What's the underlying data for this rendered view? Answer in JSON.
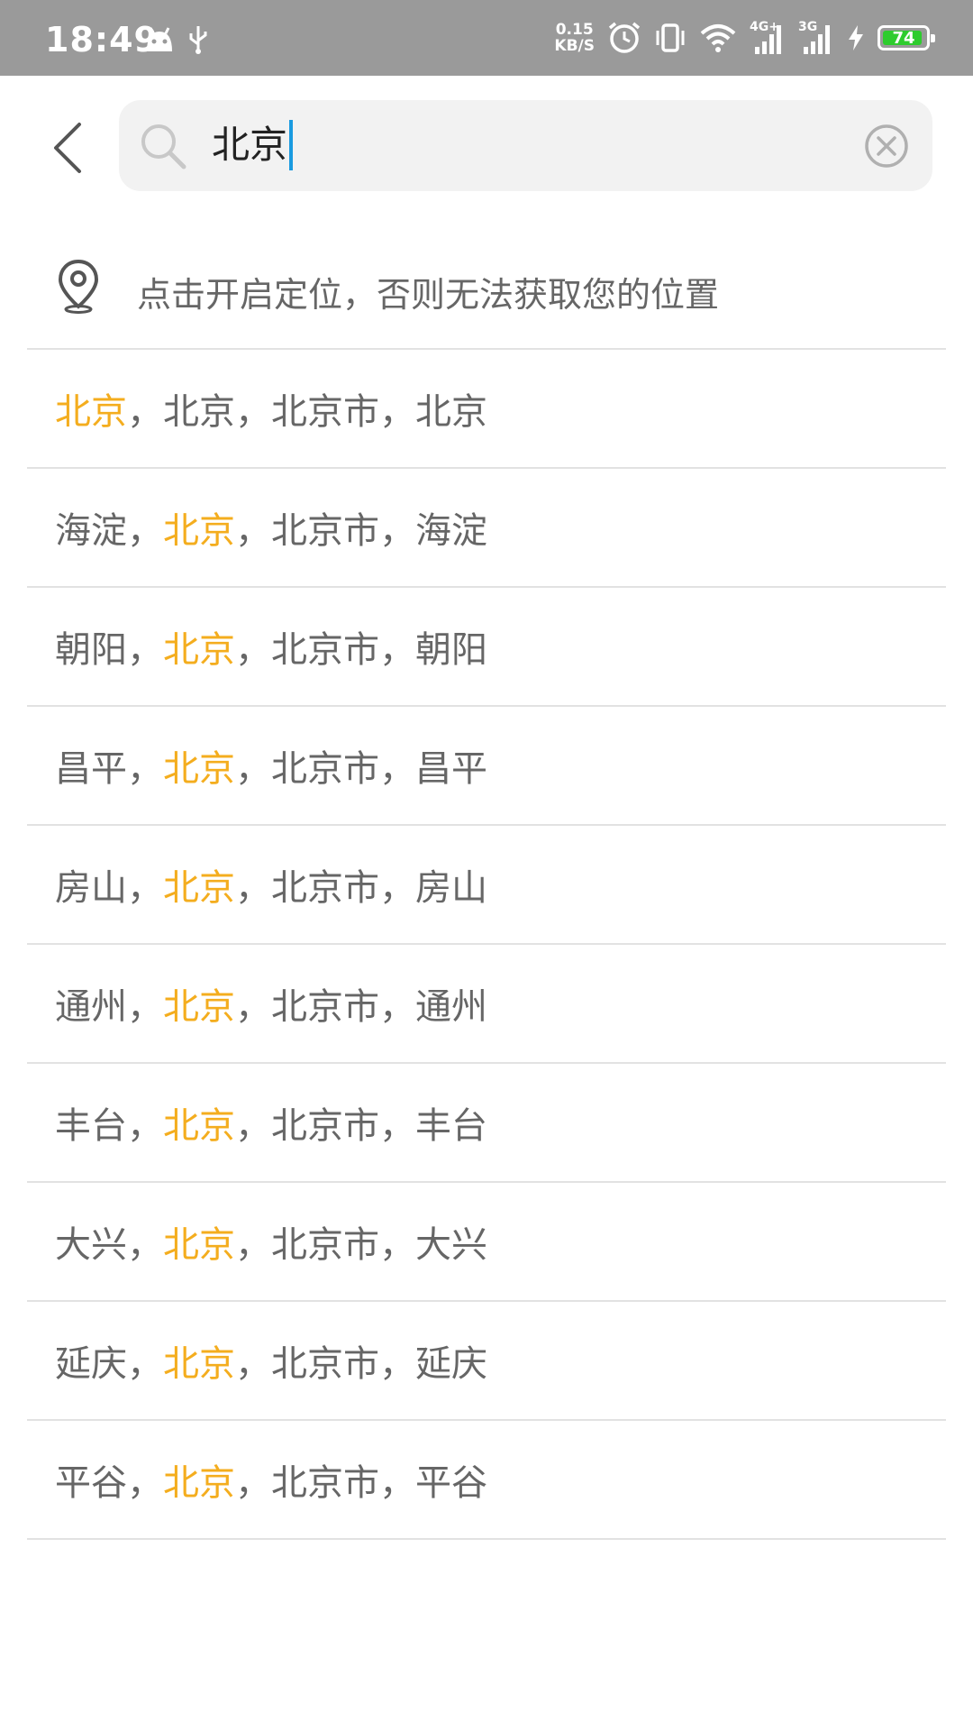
{
  "status_bar": {
    "time": "18:49",
    "speed_value": "0.15",
    "speed_unit": "KB/S",
    "net1": "4G+",
    "net2": "3G",
    "battery_level": "74",
    "battery_color": "#2ecc2e"
  },
  "search": {
    "query": "北京"
  },
  "location_prompt": "点击开启定位，否则无法获取您的位置",
  "colors": {
    "highlight": "#f4ad1e",
    "text": "#666666",
    "cursor": "#1a9be0"
  },
  "results": [
    {
      "parts": [
        "北京",
        "北京",
        "北京市",
        "北京"
      ],
      "highlight": 0
    },
    {
      "parts": [
        "海淀",
        "北京",
        "北京市",
        "海淀"
      ],
      "highlight": 1
    },
    {
      "parts": [
        "朝阳",
        "北京",
        "北京市",
        "朝阳"
      ],
      "highlight": 1
    },
    {
      "parts": [
        "昌平",
        "北京",
        "北京市",
        "昌平"
      ],
      "highlight": 1
    },
    {
      "parts": [
        "房山",
        "北京",
        "北京市",
        "房山"
      ],
      "highlight": 1
    },
    {
      "parts": [
        "通州",
        "北京",
        "北京市",
        "通州"
      ],
      "highlight": 1
    },
    {
      "parts": [
        "丰台",
        "北京",
        "北京市",
        "丰台"
      ],
      "highlight": 1
    },
    {
      "parts": [
        "大兴",
        "北京",
        "北京市",
        "大兴"
      ],
      "highlight": 1
    },
    {
      "parts": [
        "延庆",
        "北京",
        "北京市",
        "延庆"
      ],
      "highlight": 1
    },
    {
      "parts": [
        "平谷",
        "北京",
        "北京市",
        "平谷"
      ],
      "highlight": 1
    }
  ],
  "separator": "，"
}
